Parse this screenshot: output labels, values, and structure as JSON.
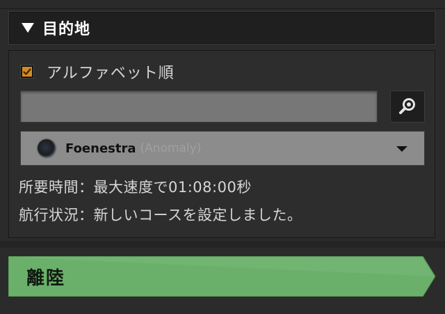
{
  "section": {
    "title": "目的地",
    "toggle_icon": "triangle-down-icon"
  },
  "options": {
    "alphabetical_label": "アルファベット順",
    "alphabetical_checked": true
  },
  "search": {
    "value": "",
    "placeholder": "",
    "button_icon": "magnifier-icon"
  },
  "destination": {
    "name": "Foenestra",
    "type": "(Anomaly)",
    "icon": "planet-icon"
  },
  "info": {
    "travel_time": "所要時間：最大速度で01:08:00秒",
    "nav_status": "航行状況：新しいコースを設定しました。"
  },
  "actions": {
    "launch_label": "離陸"
  },
  "colors": {
    "checkbox_accent": "#d58a1e",
    "launch_green": "#6ab06a"
  }
}
